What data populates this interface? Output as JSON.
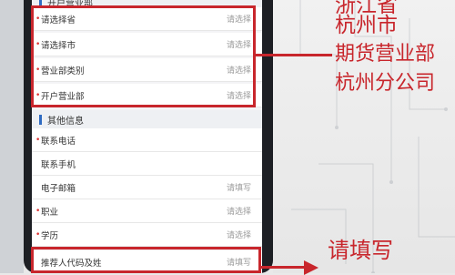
{
  "top_section": {
    "title": "开户营业部"
  },
  "branch_rows": [
    {
      "label": "请选择省",
      "value": "请选择"
    },
    {
      "label": "请选择市",
      "value": "请选择"
    },
    {
      "label": "营业部类别",
      "value": "请选择"
    },
    {
      "label": "开户营业部",
      "value": "请选择"
    }
  ],
  "other_section": {
    "title": "其他信息"
  },
  "other_rows": [
    {
      "label": "联系电话",
      "value": ""
    },
    {
      "label": "联系手机",
      "value": ""
    },
    {
      "label": "电子邮箱",
      "value": "请填写"
    },
    {
      "label": "职业",
      "value": "请选择"
    },
    {
      "label": "学历",
      "value": "请选择"
    },
    {
      "label": "推荐人代码及姓",
      "value": "请填写"
    }
  ],
  "annotations": {
    "top": [
      "浙江省",
      "杭州市",
      "期货营业部",
      "杭州分公司"
    ],
    "bottom": "请填写"
  },
  "colors": {
    "accent": "#c8262c",
    "section_bar": "#2f6bc2"
  }
}
